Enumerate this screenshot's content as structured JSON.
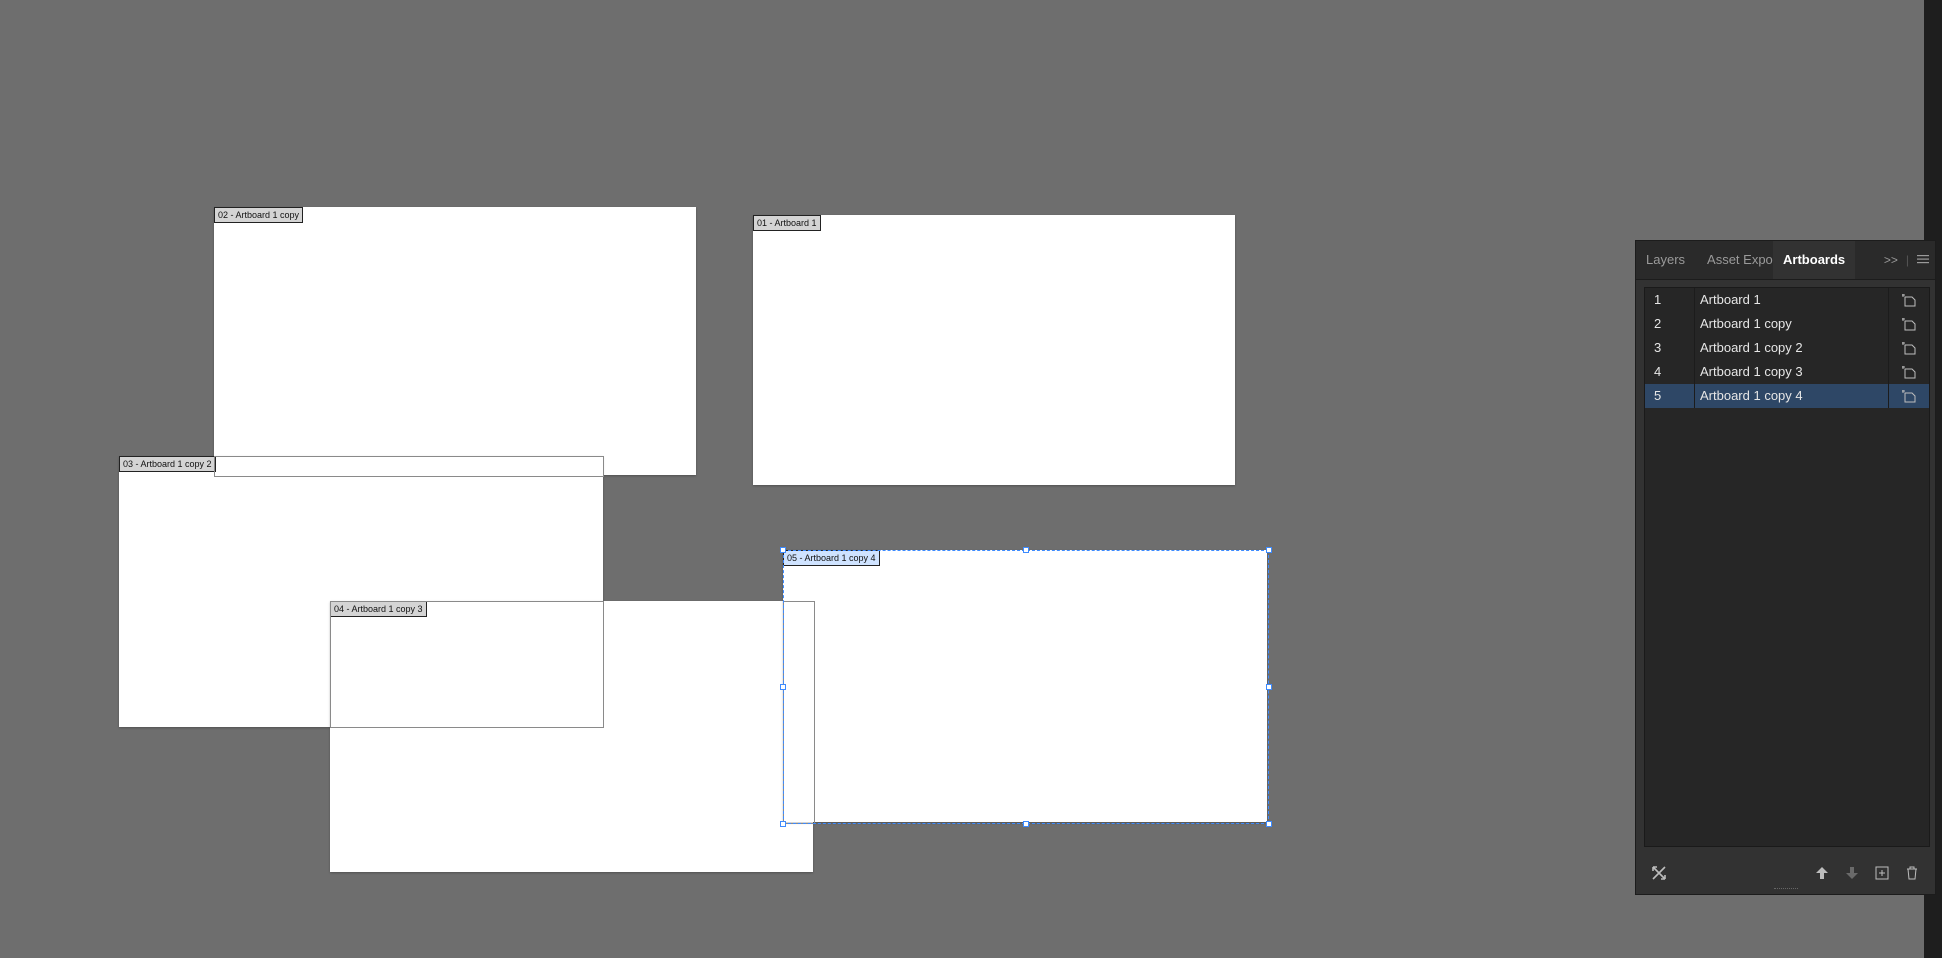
{
  "artboards": [
    {
      "id": "ab2",
      "label": "02 - Artboard 1 copy"
    },
    {
      "id": "ab1",
      "label": "01 - Artboard 1"
    },
    {
      "id": "ab3",
      "label": "03 - Artboard 1 copy 2"
    },
    {
      "id": "ab4",
      "label": "04 - Artboard 1 copy 3"
    },
    {
      "id": "ab5",
      "label": "05 - Artboard 1 copy 4",
      "selected": true
    }
  ],
  "panel": {
    "tabs": [
      "Layers",
      "Asset Expo",
      "Artboards"
    ],
    "active_tab": "Artboards",
    "collapse_icon": ">>",
    "menu_icon": "hamburger-icon",
    "rows": [
      {
        "num": "1",
        "name": "Artboard 1"
      },
      {
        "num": "2",
        "name": "Artboard 1 copy"
      },
      {
        "num": "3",
        "name": "Artboard 1 copy 2"
      },
      {
        "num": "4",
        "name": "Artboard 1 copy 3"
      },
      {
        "num": "5",
        "name": "Artboard 1 copy 4",
        "selected": true
      }
    ],
    "footer_icons": [
      "rearrange-icon",
      "move-up-icon",
      "move-down-icon",
      "new-artboard-icon",
      "delete-icon"
    ]
  },
  "colors": {
    "canvas": "#6e6e6e",
    "panel": "#323232",
    "selection": "#3d8bff",
    "row_selected": "#2e4766"
  }
}
